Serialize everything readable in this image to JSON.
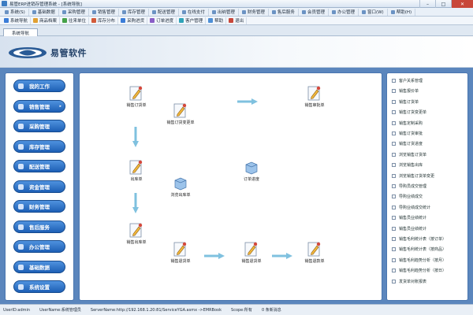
{
  "window": {
    "title": "易管ERP进销存管理系统 - [系统导航]"
  },
  "menubar": {
    "items": [
      "系统(S)",
      "基础数据",
      "采购管理",
      "销售管理",
      "库存管理",
      "配送管理",
      "在线支付",
      "出纳管理",
      "财务管理",
      "售后服务",
      "会员管理",
      "办公管理",
      "窗口(W)",
      "帮助(H)"
    ]
  },
  "toolbar": {
    "items": [
      {
        "label": "系统导航",
        "color": "#3b7dd8"
      },
      {
        "label": "商品档案",
        "color": "#e0a032"
      },
      {
        "label": "往来单位",
        "color": "#46a24a"
      },
      {
        "label": "库存分布",
        "color": "#d35b3a"
      },
      {
        "label": "采购进货",
        "color": "#3b7dd8"
      },
      {
        "label": "订单进度",
        "color": "#8a5ec7"
      },
      {
        "label": "客户管理",
        "color": "#2fa3b8"
      },
      {
        "label": "帮助",
        "color": "#4d8fd6"
      },
      {
        "label": "退出",
        "color": "#c8473a"
      }
    ]
  },
  "tab": {
    "label": "系统导航"
  },
  "banner": {
    "logo_text": "易管软件"
  },
  "sidebar": {
    "items": [
      "我的工作",
      "销售管理",
      "采购管理",
      "库存管理",
      "配送管理",
      "资金管理",
      "财务管理",
      "售后服务",
      "办公管理",
      "基础数据",
      "系统设置"
    ]
  },
  "flow": {
    "nodes": {
      "sales_order": "销售订货单",
      "order_change": "销售订货变更单",
      "order_approve": "销售审批单",
      "outbound": "出库单",
      "browse_stock": "浏览出库单",
      "order_progress": "订单进度",
      "sales_out": "销售出库单",
      "sales_return_req": "销售退货单",
      "sales_return": "销售退货单",
      "sales_refund": "销售退款单"
    }
  },
  "rightpanel": {
    "items": [
      "客户关系管理",
      "销售报价单",
      "销售订货单",
      "销售订货变更单",
      "销售定制采购",
      "销售订货审批",
      "销售订货进度",
      "浏览销售订货单",
      "浏览销售出库",
      "浏览销售订货单变更",
      "导购员成交管理",
      "导购业绩成交",
      "导购业绩成交统计",
      "销售员业绩统计",
      "销售员业绩统计",
      "销售毛利统计表（按订单）",
      "销售毛利统计表（按商品）",
      "销售毛利趋势分析（按月）",
      "销售毛利趋势分析（按日）",
      "发货单对账报表"
    ]
  },
  "status": {
    "user": "UserID:admin",
    "username": "UserName:系统管理员",
    "server": "ServerName:http://192.168.1.20:81/ServiceYGA.asmx ->EMRBook",
    "scope": "Scope:所有",
    "new_msgs": "0 条新消息"
  }
}
